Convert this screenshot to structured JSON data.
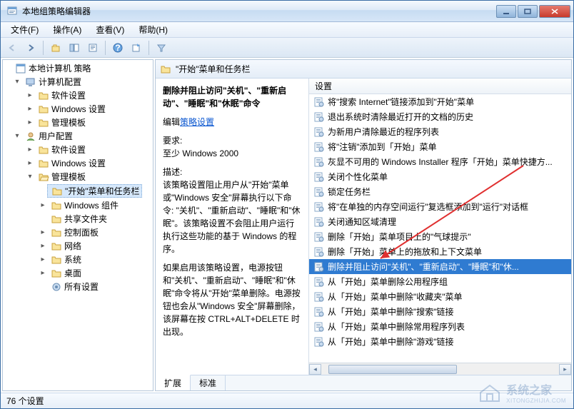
{
  "window": {
    "title": "本地组策略编辑器"
  },
  "menu": {
    "file": "文件(F)",
    "action": "操作(A)",
    "view": "查看(V)",
    "help": "帮助(H)"
  },
  "tree": {
    "root": "本地计算机 策略",
    "computer_cfg": "计算机配置",
    "cc_soft": "软件设置",
    "cc_win": "Windows 设置",
    "cc_admin": "管理模板",
    "user_cfg": "用户配置",
    "uc_soft": "软件设置",
    "uc_win": "Windows 设置",
    "uc_admin": "管理模板",
    "start_taskbar": "\"开始\"菜单和任务栏",
    "win_comp": "Windows 组件",
    "shared": "共享文件夹",
    "ctrl_panel": "控制面板",
    "network": "网络",
    "system": "系统",
    "desktop": "桌面",
    "all_settings": "所有设置"
  },
  "right": {
    "header": "\"开始\"菜单和任务栏",
    "detail_title": "删除并阻止访问\"关机\"、\"重新启动\"、\"睡眠\"和\"休眠\"命令",
    "edit_label": "编辑",
    "edit_link": "策略设置",
    "req_label": "要求:",
    "req_value": "至少 Windows 2000",
    "desc_label": "描述:",
    "desc_body": "该策略设置阻止用户从\"开始\"菜单或\"Windows 安全\"屏幕执行以下命令: \"关机\"、\"重新启动\"、\"睡眠\"和\"休眠\"。该策略设置不会阻止用户运行执行这些功能的基于 Windows 的程序。",
    "desc_body2": "如果启用该策略设置，电源按钮和\"关机\"、\"重新启动\"、\"睡眠\"和\"休眠\"命令将从\"开始\"菜单删除。电源按钮也会从\"Windows 安全\"屏幕删除，该屏幕在按 CTRL+ALT+DELETE 时出现。",
    "col_setting": "设置",
    "items": [
      "将\"搜索 Internet\"链接添加到\"开始\"菜单",
      "退出系统时清除最近打开的文档的历史",
      "为新用户清除最近的程序列表",
      "将\"注销\"添加到「开始」菜单",
      "灰显不可用的 Windows Installer 程序「开始」菜单快捷方...",
      "关闭个性化菜单",
      "锁定任务栏",
      "将\"在单独的内存空间运行\"复选框添加到\"运行\"对话框",
      "关闭通知区域清理",
      "删除「开始」菜单项目上的\"气球提示\"",
      "删除「开始」菜单上的拖放和上下文菜单",
      "删除并阻止访问\"关机\"、\"重新启动\"、\"睡眠\"和\"休...",
      "从「开始」菜单删除公用程序组",
      "从「开始」菜单中删除\"收藏夹\"菜单",
      "从「开始」菜单中删除\"搜索\"链接",
      "从「开始」菜单中删除常用程序列表",
      "从「开始」菜单中删除\"游戏\"链接"
    ],
    "selected_index": 11,
    "tabs": {
      "extended": "扩展",
      "standard": "标准"
    }
  },
  "status": {
    "text": "76 个设置"
  },
  "watermark": {
    "text": "系统之家",
    "sub": "XITONGZHIJIA.COM"
  }
}
